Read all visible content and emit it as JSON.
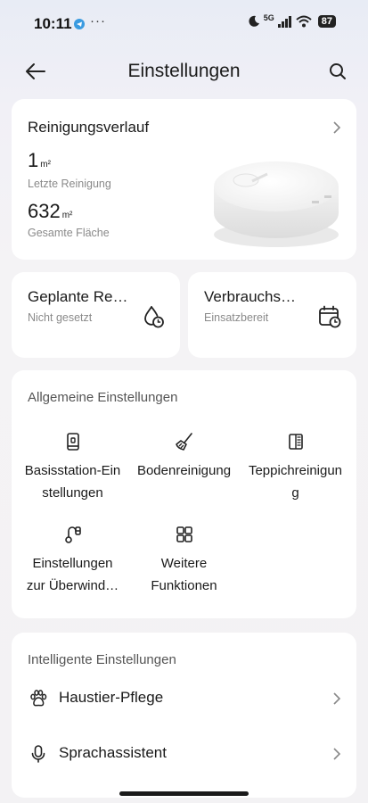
{
  "status_bar": {
    "time": "10:11",
    "dots": "···",
    "network": "5G",
    "battery": "87"
  },
  "header": {
    "title": "Einstellungen"
  },
  "history": {
    "title": "Reinigungsverlauf",
    "last_value": "1",
    "last_unit": "m²",
    "last_label": "Letzte Reinigung",
    "total_value": "632",
    "total_unit": "m²",
    "total_label": "Gesamte Fläche"
  },
  "scheduled": {
    "title": "Geplante Re…",
    "subtitle": "Nicht gesetzt"
  },
  "consumables": {
    "title": "Verbrauchs…",
    "subtitle": "Einsatzbereit"
  },
  "general": {
    "title": "Allgemeine Einstellungen",
    "items": [
      {
        "line1": "Basisstation-Ein",
        "line2": "stellungen",
        "icon": "base-station-icon"
      },
      {
        "line1": "Bodenreinigung",
        "line2": "",
        "icon": "mop-icon"
      },
      {
        "line1": "Teppichreinigun",
        "line2": "g",
        "icon": "carpet-icon"
      },
      {
        "line1": "Einstellungen",
        "line2": "zur Überwind…",
        "icon": "obstacle-icon"
      },
      {
        "line1": "Weitere",
        "line2": "Funktionen",
        "icon": "grid-icon"
      }
    ]
  },
  "smart": {
    "title": "Intelligente Einstellungen",
    "items": [
      {
        "label": "Haustier-Pflege",
        "icon": "paw-icon"
      },
      {
        "label": "Sprachassistent",
        "icon": "microphone-icon"
      }
    ]
  }
}
